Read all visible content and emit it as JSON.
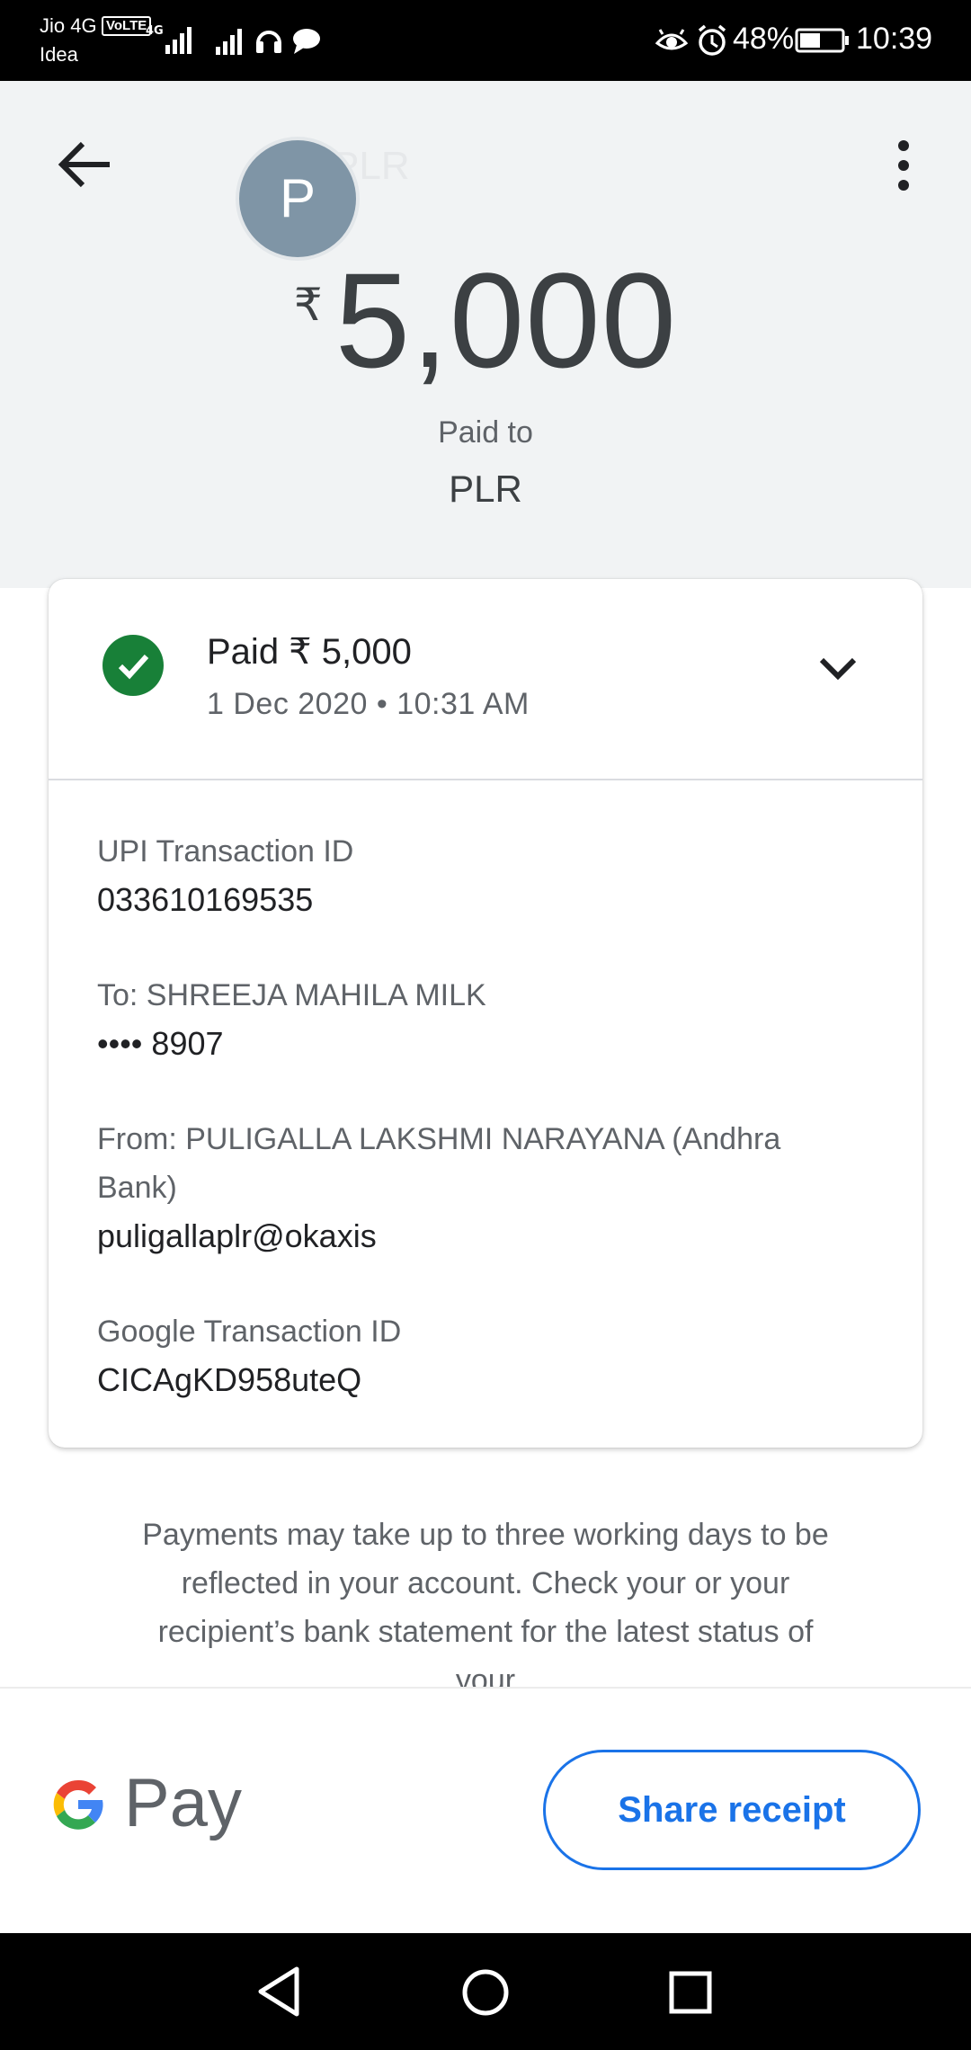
{
  "status_bar": {
    "carrier_1": "Jio 4G",
    "volte": "VoLTE",
    "carrier_2": "Idea",
    "battery": "48%",
    "time": "10:39"
  },
  "header": {
    "avatar_initial": "P",
    "ghost_name": "PLR",
    "currency": "₹",
    "amount": "5,000",
    "paid_to_label": "Paid to",
    "payee_name": "PLR"
  },
  "card": {
    "status_title": "Paid ₹ 5,000",
    "date_time": "1 Dec 2020 • 10:31 AM",
    "upi_label": "UPI Transaction ID",
    "upi_value": "033610169535",
    "to_label": "To: SHREEJA MAHILA MILK",
    "to_value": "•••• 8907",
    "from_label_line1": "From: PULIGALLA LAKSHMI NARAYANA (Andhra",
    "from_label_line2": "Bank)",
    "from_value": "puligallaplr@okaxis",
    "google_label": "Google Transaction ID",
    "google_value": "CICAgKD958uteQ"
  },
  "disclaimer": "Payments may take up to three working days to be reflected in your account. Check your or your recipient’s bank statement for the latest status of your",
  "footer": {
    "logo_text": "Pay",
    "share_button": "Share receipt"
  },
  "colors": {
    "success": "#188038",
    "accent": "#1a73e8",
    "header_bg": "#f1f3f4"
  }
}
